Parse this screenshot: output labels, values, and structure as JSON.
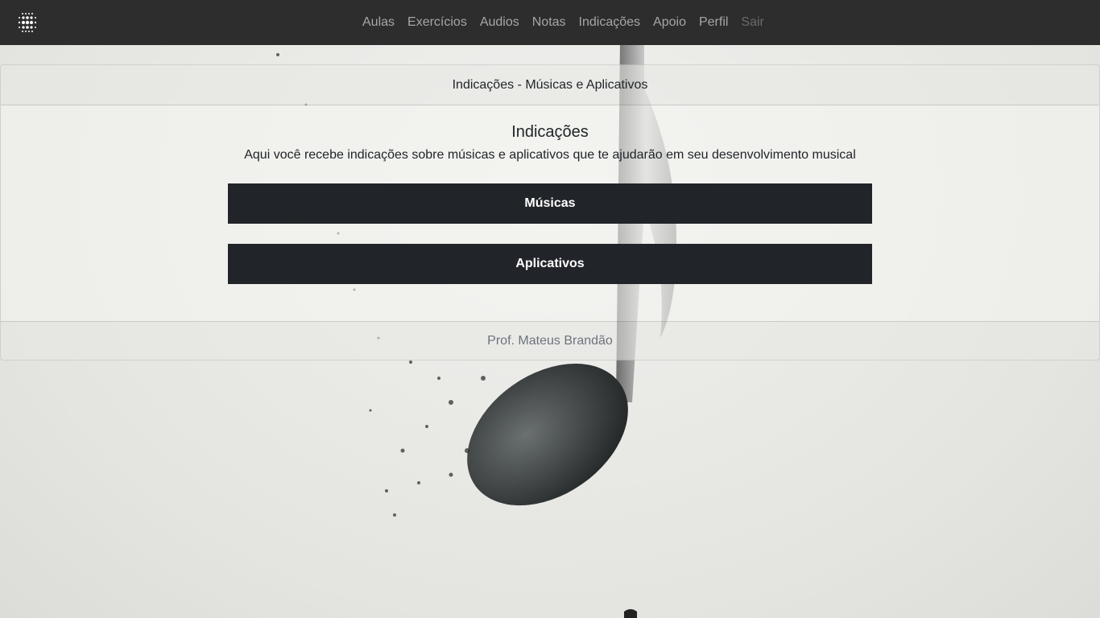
{
  "navbar": {
    "logo": "dots-logo",
    "items": [
      {
        "label": "Aulas"
      },
      {
        "label": "Exercícios"
      },
      {
        "label": "Audios"
      },
      {
        "label": "Notas"
      },
      {
        "label": "Indicações"
      },
      {
        "label": "Apoio"
      },
      {
        "label": "Perfil"
      },
      {
        "label": "Sair"
      }
    ]
  },
  "card": {
    "header": "Indicações - Músicas e Aplicativos",
    "title": "Indicações",
    "description": "Aqui você recebe indicações sobre músicas e aplicativos que te ajudarão em seu desenvolvimento musical",
    "buttons": [
      {
        "label": "Músicas"
      },
      {
        "label": "Aplicativos"
      }
    ],
    "footer": "Prof. Mateus Brandão"
  }
}
